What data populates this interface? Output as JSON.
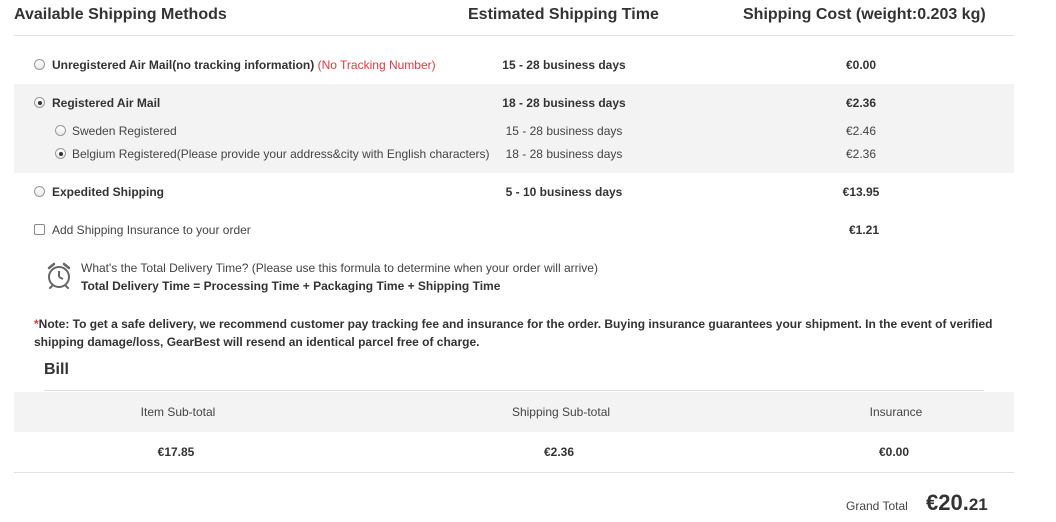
{
  "headers": {
    "methods": "Available Shipping Methods",
    "time": "Estimated Shipping Time",
    "cost": "Shipping Cost (weight:0.203 kg)"
  },
  "methods": [
    {
      "label": "Unregistered Air Mail(no tracking information)",
      "warning": "(No Tracking Number)",
      "time": "15 - 28 business days",
      "cost": "€0.00",
      "checked": false
    },
    {
      "label": "Registered Air Mail",
      "time": "18 - 28 business days",
      "cost": "€2.36",
      "checked": true,
      "options": [
        {
          "label": "Sweden Registered",
          "time": "15 - 28 business days",
          "cost": "€2.46",
          "checked": false
        },
        {
          "label": "Belgium Registered(Please provide your address&city with English characters)",
          "time": "18 - 28 business days",
          "cost": "€2.36",
          "checked": true
        }
      ]
    },
    {
      "label": "Expedited Shipping",
      "time": "5 - 10 business days",
      "cost": "€13.95",
      "checked": false
    }
  ],
  "insurance": {
    "label": "Add Shipping Insurance to your order",
    "cost": "€1.21",
    "checked": false
  },
  "delivery_info": {
    "question": "What's the Total Delivery Time? (Please use this formula to determine when your order will arrive)",
    "formula": "Total Delivery Time = Processing Time + Packaging Time + Shipping Time"
  },
  "note": {
    "star": "*",
    "text": "Note: To get a safe delivery, we recommend customer pay tracking fee and insurance for the order. Buying insurance guarantees your shipment. In the event of verified shipping damage/loss, GearBest will resend an identical parcel free of charge."
  },
  "bill": {
    "title": "Bill",
    "headers": [
      "Item Sub-total",
      "Shipping Sub-total",
      "Insurance"
    ],
    "values": [
      "€17.85",
      "€2.36",
      "€0.00"
    ],
    "grand_total_label": "Grand Total",
    "grand_total_main": "€20.",
    "grand_total_cents": "21"
  }
}
